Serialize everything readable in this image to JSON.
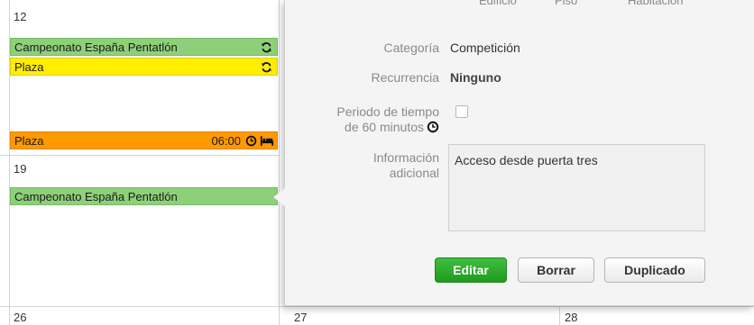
{
  "calendar": {
    "day_numbers": [
      "12",
      "19",
      "26",
      "27",
      "28"
    ],
    "events": [
      {
        "label": "Campeonato España Pentatlón",
        "icon": "recurrence-icon"
      },
      {
        "label": "Plaza",
        "icon": "recurrence-icon"
      },
      {
        "label": "Plaza",
        "time": "06:00",
        "icons": [
          "clock-icon",
          "bed-icon"
        ]
      },
      {
        "label": "Campeonato España Pentatlón"
      }
    ],
    "colors": {
      "green": "#8ed07a",
      "yellow": "#ffee00",
      "orange": "#ff9900"
    }
  },
  "popup": {
    "cut_headers": [
      "Edificio",
      "Piso",
      "Habitación"
    ],
    "fields": {
      "category": {
        "label": "Categoría",
        "value": "Competición"
      },
      "recurrence": {
        "label": "Recurrencia",
        "value": "Ninguno"
      },
      "time_period": {
        "label_line1": "Periodo de tiempo",
        "label_line2": "de 60 minutos",
        "checked": false
      },
      "additional_info": {
        "label_line1": "Información",
        "label_line2": "adicional",
        "value": "Acceso desde puerta tres"
      }
    },
    "buttons": {
      "edit": "Editar",
      "delete": "Borrar",
      "duplicate": "Duplicado"
    },
    "colors": {
      "primary": "#22a322"
    }
  }
}
